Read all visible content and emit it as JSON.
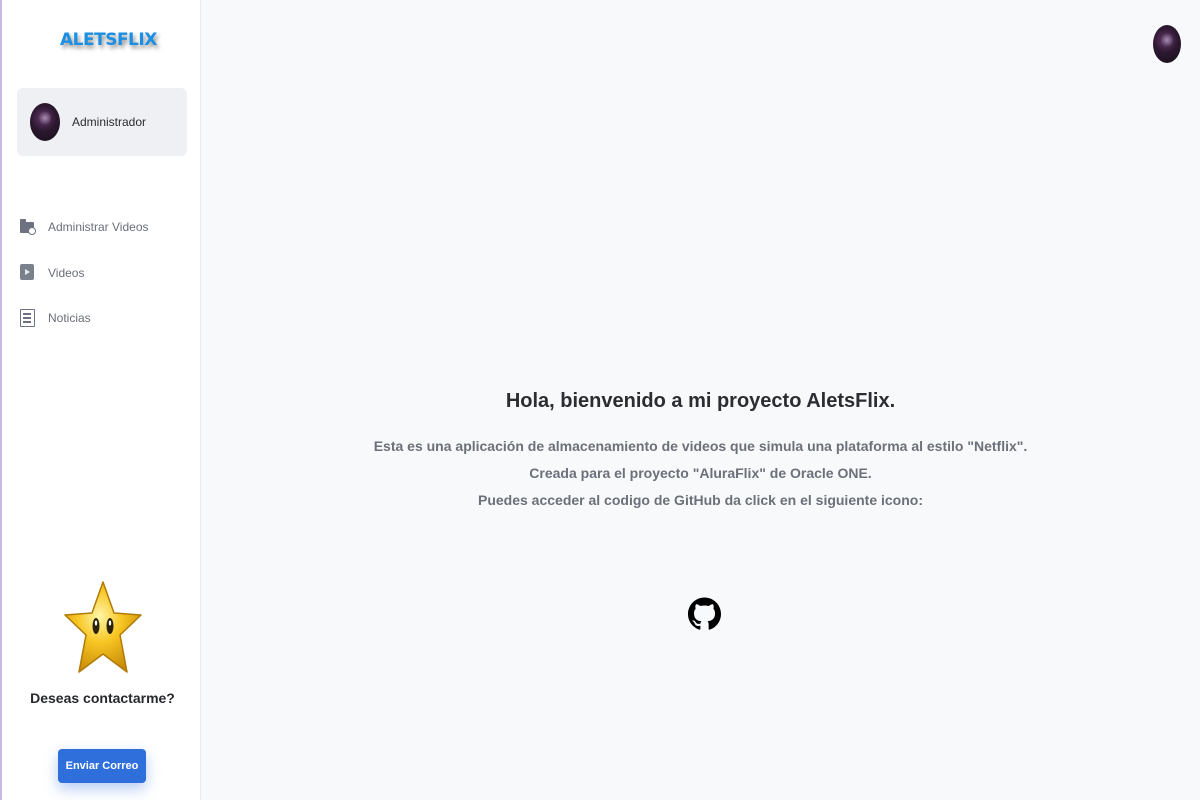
{
  "sidebar": {
    "brand": "ALETSFLIX",
    "user": {
      "name": "Administrador"
    },
    "nav": [
      {
        "label": "Administrar Videos",
        "icon": "folder-plus-icon"
      },
      {
        "label": "Videos",
        "icon": "video-file-icon"
      },
      {
        "label": "Noticias",
        "icon": "newspaper-icon"
      }
    ],
    "contact": {
      "title": "Deseas contactarme?",
      "button_label": "Enviar Correo",
      "image": "star-icon"
    }
  },
  "main": {
    "title": "Hola, bienvenido a mi proyecto AletsFlix.",
    "lines": [
      "Esta es una aplicación de almacenamiento de videos que simula una plataforma al estilo \"Netflix\".",
      "Creada para el proyecto \"AluraFlix\" de Oracle ONE.",
      "Puedes acceder al codigo de GitHub da click en el siguiente icono:"
    ],
    "github_icon": "github-icon"
  },
  "colors": {
    "accent": "#2f6fdc",
    "brand": "#1a8fe3",
    "background": "#f8f9fb"
  }
}
